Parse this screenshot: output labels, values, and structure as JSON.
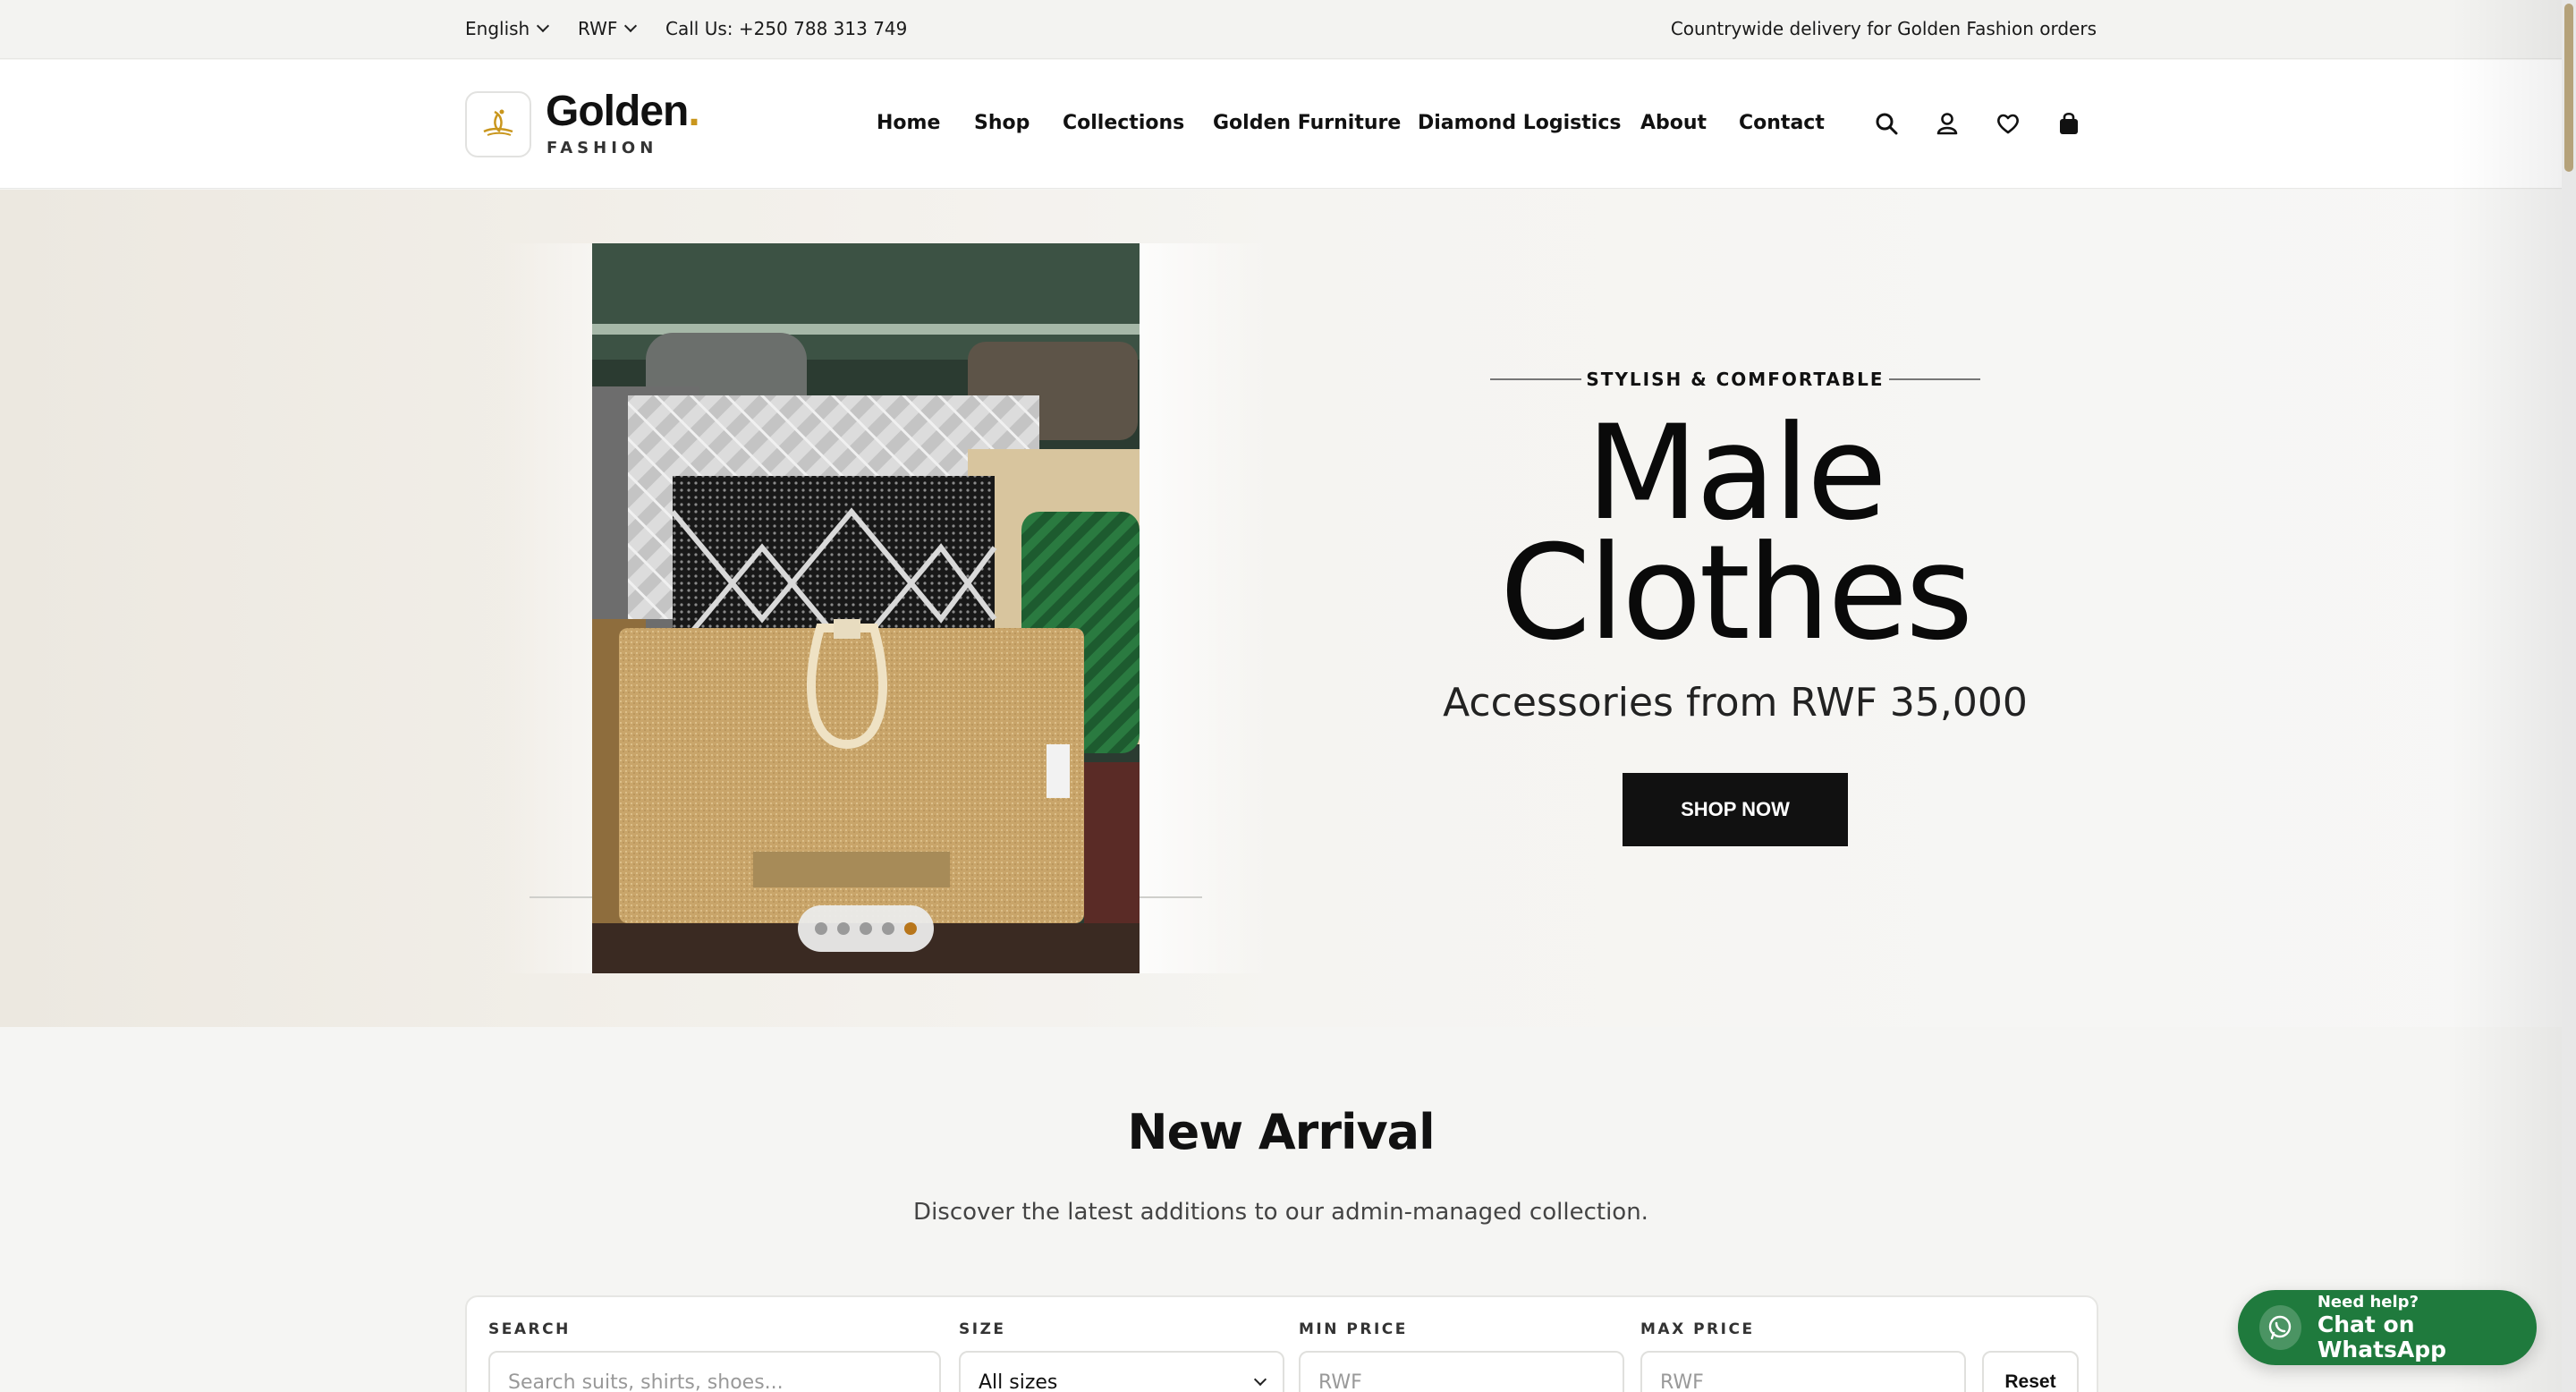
{
  "topbar": {
    "language": "English",
    "currency": "RWF",
    "phone": "Call Us: +250 788 313 749",
    "promo": "Countrywide delivery for Golden Fashion orders"
  },
  "header": {
    "logo_title": "Golden",
    "logo_dot": ".",
    "logo_sub": "FASHION",
    "nav": [
      "Home",
      "Shop",
      "Collections",
      "Golden Furniture",
      "Diamond Logistics",
      "About",
      "Contact"
    ],
    "icons": [
      "search-icon",
      "user-icon",
      "heart-icon",
      "bag-icon"
    ]
  },
  "hero": {
    "tagline": "STYLISH & COMFORTABLE",
    "title_line1": "Male",
    "title_line2": "Clothes",
    "subtitle": "Accessories from RWF 35,000",
    "cta": "SHOP NOW",
    "slides": {
      "count": 5,
      "active": 5
    }
  },
  "new_arrival": {
    "title": "New Arrival",
    "subtitle": "Discover the latest additions to our admin-managed collection."
  },
  "filters": {
    "search_label": "SEARCH",
    "search_placeholder": "Search suits, shirts, shoes...",
    "size_label": "SIZE",
    "size_value": "All sizes",
    "min_label": "MIN PRICE",
    "min_placeholder": "RWF",
    "max_label": "MAX PRICE",
    "max_placeholder": "RWF",
    "reset": "Reset"
  },
  "whatsapp": {
    "small": "Need help?",
    "big": "Chat on WhatsApp"
  },
  "colors": {
    "accent": "#c9961d",
    "whatsapp": "#1f7a3d",
    "button": "#111111"
  }
}
